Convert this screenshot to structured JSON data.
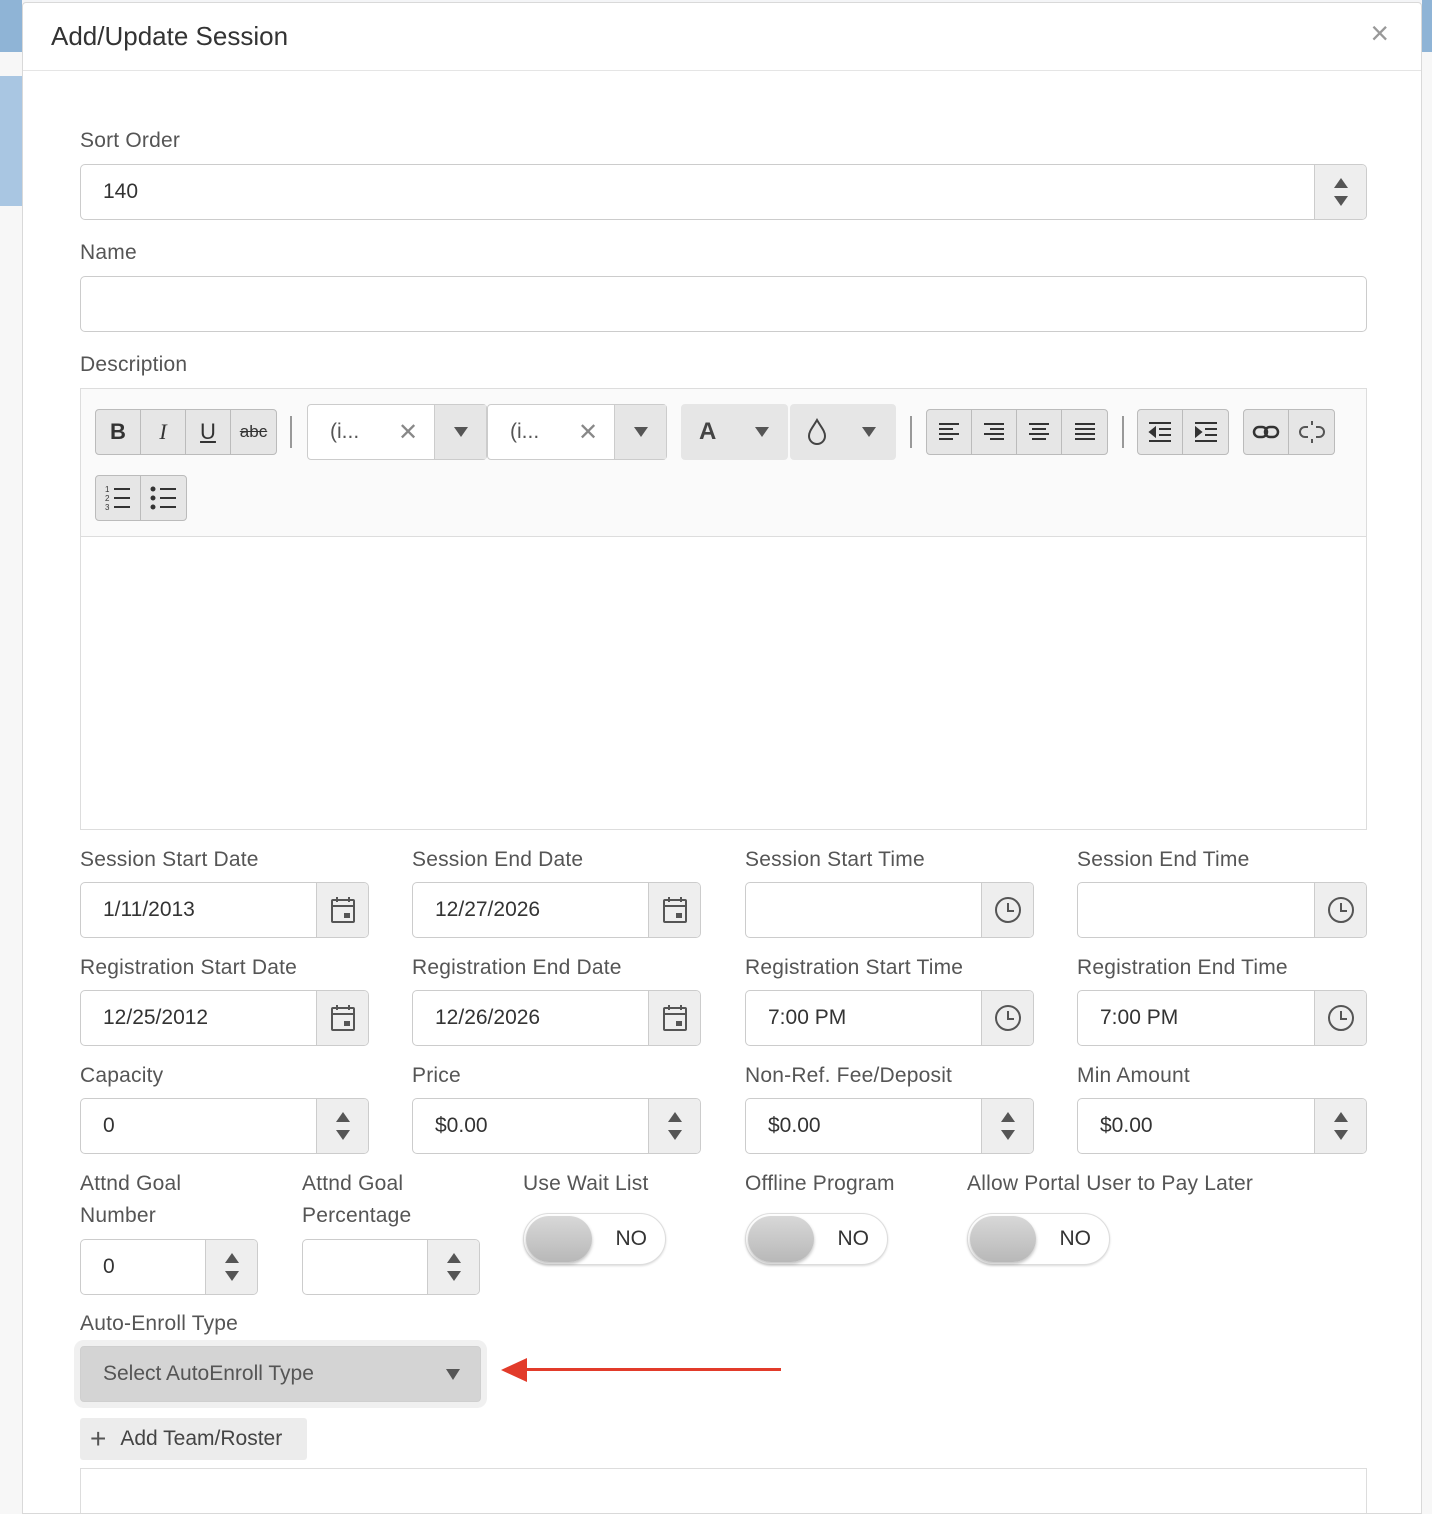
{
  "modal": {
    "title": "Add/Update Session",
    "close_label": "×"
  },
  "sort_order": {
    "label": "Sort Order",
    "value": "140"
  },
  "name": {
    "label": "Name",
    "value": ""
  },
  "description": {
    "label": "Description",
    "toolbar": {
      "bold": "B",
      "italic": "I",
      "underline": "U",
      "strike": "abc",
      "font_family": "(i...",
      "font_size": "(i...",
      "clear_x": "✕",
      "font_color": "A",
      "icons": [
        "bold-icon",
        "italic-icon",
        "underline-icon",
        "strikethrough-icon",
        "text-color-icon",
        "highlight-color-icon",
        "align-left-icon",
        "align-right-icon",
        "align-center-icon",
        "justify-icon",
        "outdent-icon",
        "indent-icon",
        "link-icon",
        "unlink-icon",
        "ordered-list-icon",
        "unordered-list-icon"
      ]
    }
  },
  "dates": {
    "session_start_date": {
      "label": "Session Start Date",
      "value": "1/11/2013"
    },
    "session_end_date": {
      "label": "Session End Date",
      "value": "12/27/2026"
    },
    "session_start_time": {
      "label": "Session Start Time",
      "value": ""
    },
    "session_end_time": {
      "label": "Session End Time",
      "value": ""
    },
    "registration_start_date": {
      "label": "Registration Start Date",
      "value": "12/25/2012"
    },
    "registration_end_date": {
      "label": "Registration End Date",
      "value": "12/26/2026"
    },
    "registration_start_time": {
      "label": "Registration Start Time",
      "value": "7:00 PM"
    },
    "registration_end_time": {
      "label": "Registration End Time",
      "value": "7:00 PM"
    }
  },
  "amounts": {
    "capacity": {
      "label": "Capacity",
      "value": "0"
    },
    "price": {
      "label": "Price",
      "value": "$0.00"
    },
    "non_ref_fee": {
      "label": "Non-Ref. Fee/Deposit",
      "value": "$0.00"
    },
    "min_amount": {
      "label": "Min Amount",
      "value": "$0.00"
    }
  },
  "goals": {
    "attnd_goal_number": {
      "label_line1": "Attnd Goal",
      "label_line2": "Number",
      "value": "0"
    },
    "attnd_goal_percentage": {
      "label_line1": "Attnd Goal",
      "label_line2": "Percentage",
      "value": ""
    }
  },
  "toggles": {
    "use_wait_list": {
      "label": "Use Wait List",
      "state": "NO"
    },
    "offline_program": {
      "label": "Offline Program",
      "state": "NO"
    },
    "pay_later": {
      "label": "Allow Portal User to Pay Later",
      "state": "NO"
    }
  },
  "auto_enroll": {
    "label": "Auto-Enroll Type",
    "selected": "Select AutoEnroll Type"
  },
  "add_team": {
    "icon": "+",
    "label": "Add Team/Roster"
  },
  "colors": {
    "accent_arrow": "#e23b2a",
    "addon_bg": "#eeeeee",
    "border": "#cccccc"
  }
}
